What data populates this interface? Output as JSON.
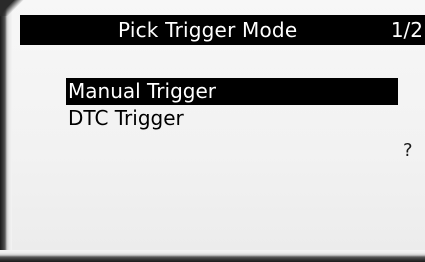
{
  "header": {
    "title": "Pick Trigger Mode",
    "page_indicator": "1/2"
  },
  "menu": {
    "items": [
      {
        "label": "Manual Trigger",
        "selected": true
      },
      {
        "label": "DTC Trigger",
        "selected": false
      }
    ]
  },
  "help": {
    "glyph": "?",
    "icon": "question-mark-icon"
  },
  "colors": {
    "title_bar": "#000000",
    "title_text": "#ffffff",
    "selection_highlight": "#000000",
    "screen_background": "#f4f4f4"
  }
}
